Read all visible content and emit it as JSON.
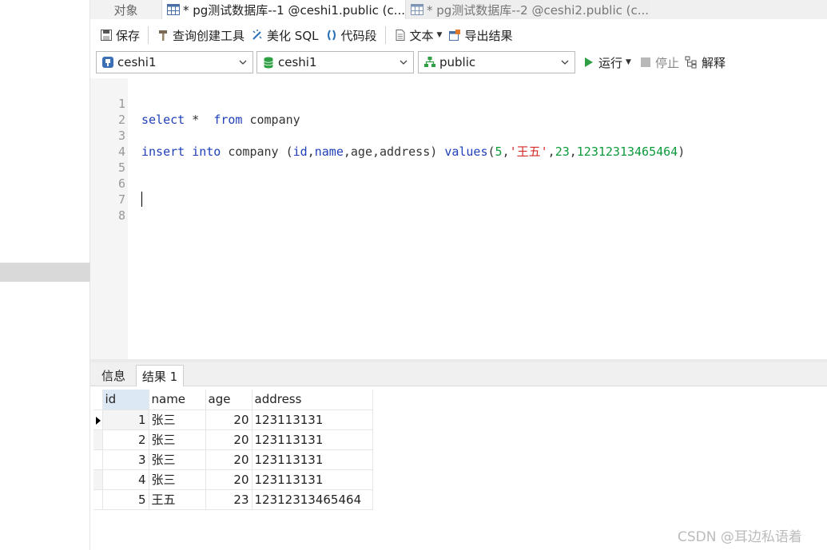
{
  "tabs": {
    "objects": "对象",
    "query1": "* pg测试数据库--1 @ceshi1.public (c...",
    "query2": "* pg测试数据库--2 @ceshi2.public (c..."
  },
  "toolbar": {
    "save": "保存",
    "query_builder": "查询创建工具",
    "beautify": "美化 SQL",
    "snippet": "代码段",
    "text": "文本",
    "export": "导出结果"
  },
  "selectors": {
    "connection": "ceshi1",
    "database": "ceshi1",
    "schema": "public",
    "run": "运行",
    "stop": "停止",
    "explain": "解释"
  },
  "editor": {
    "line_numbers": [
      "1",
      "2",
      "3",
      "4",
      "5",
      "6",
      "7",
      "8"
    ],
    "line1": {
      "select": "select",
      "star": " *  ",
      "from": "from",
      "table": " company"
    },
    "line3": {
      "insert": "insert",
      "into": "into",
      "table": " company (",
      "c_id": "id",
      "comma1": ",",
      "c_name": "name",
      "comma2": ",age,address) ",
      "values": "values",
      "open": "(",
      "v1": "5",
      "comma3": ",",
      "v2": "'王五'",
      "comma4": ",",
      "v3": "23",
      "comma5": ",",
      "v4": "12312313465464",
      "close": ")"
    }
  },
  "result_tabs": {
    "info": "信息",
    "result": "结果 1"
  },
  "grid": {
    "columns": [
      "id",
      "name",
      "age",
      "address"
    ],
    "rows": [
      [
        "1",
        "张三",
        "20",
        "123113131"
      ],
      [
        "2",
        "张三",
        "20",
        "123113131"
      ],
      [
        "3",
        "张三",
        "20",
        "123113131"
      ],
      [
        "4",
        "张三",
        "20",
        "123113131"
      ],
      [
        "5",
        "王五",
        "23",
        "12312313465464"
      ]
    ]
  },
  "watermark": "CSDN @耳边私语着"
}
